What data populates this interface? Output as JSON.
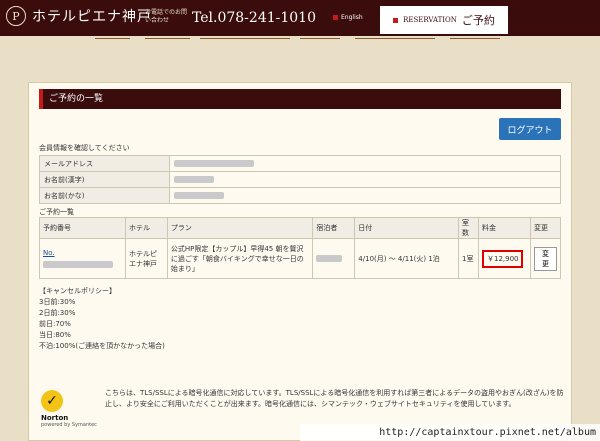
{
  "header": {
    "logo_mark": "P",
    "logo_text": "ホテルピエナ神戸",
    "tel_label": "お電話でのお問い合わせ",
    "tel_number": "Tel.078-241-1010",
    "english_label": "English",
    "reservation_label": "RESERVATION",
    "reservation_jp": "ご予約"
  },
  "section_title": "ご予約の一覧",
  "logout_label": "ログアウト",
  "confirm_text": "会員情報を確認してください",
  "member_info": {
    "rows": [
      {
        "label": "メールアドレス"
      },
      {
        "label": "お名前(漢字)"
      },
      {
        "label": "お名前(かな)"
      }
    ]
  },
  "reservation_list": {
    "title": "ご予約一覧",
    "headers": [
      "予約番号",
      "ホテル",
      "プラン",
      "宿泊者",
      "日付",
      "室数",
      "料金",
      "変更"
    ],
    "row": {
      "number": "No.",
      "hotel": "ホテルピエナ神戸",
      "plan": "公式HP限定【カップル】早得45 朝を贅沢に過ごす「朝食バイキングで幸せな一日の始まり」",
      "date": "4/10(月) ～ 4/11(火) 1泊",
      "rooms": "1室",
      "price": "￥12,900",
      "change_label": "変 更"
    }
  },
  "cancel_policy": {
    "title": "【キャンセルポリシー】",
    "lines": [
      "3日前:30%",
      "2日前:30%",
      "前日:70%",
      "当日:80%",
      "不泊:100%(ご連絡を頂かなかった場合)"
    ]
  },
  "norton": {
    "name": "Norton",
    "secured": "SECURED",
    "powered": "powered by Symantec"
  },
  "ssl_text": "こちらは、TLS/SSLによる暗号化通信に対応しています。TLS/SSLによる暗号化通信を利用すれば第三者によるデータの盗用やおぎん(改ざん)を防止し、より安全にご利用いただくことが出来ます。暗号化通信には、シマンテック・ウェブサイトセキュリティを使用しています。",
  "watermark": "http://captainxtour.pixnet.net/album",
  "colors": {
    "header_bg": "#3a0c0c",
    "accent_red": "#c31b1b",
    "logout_blue": "#2b73b8",
    "page_bg": "#e9dfc7"
  }
}
